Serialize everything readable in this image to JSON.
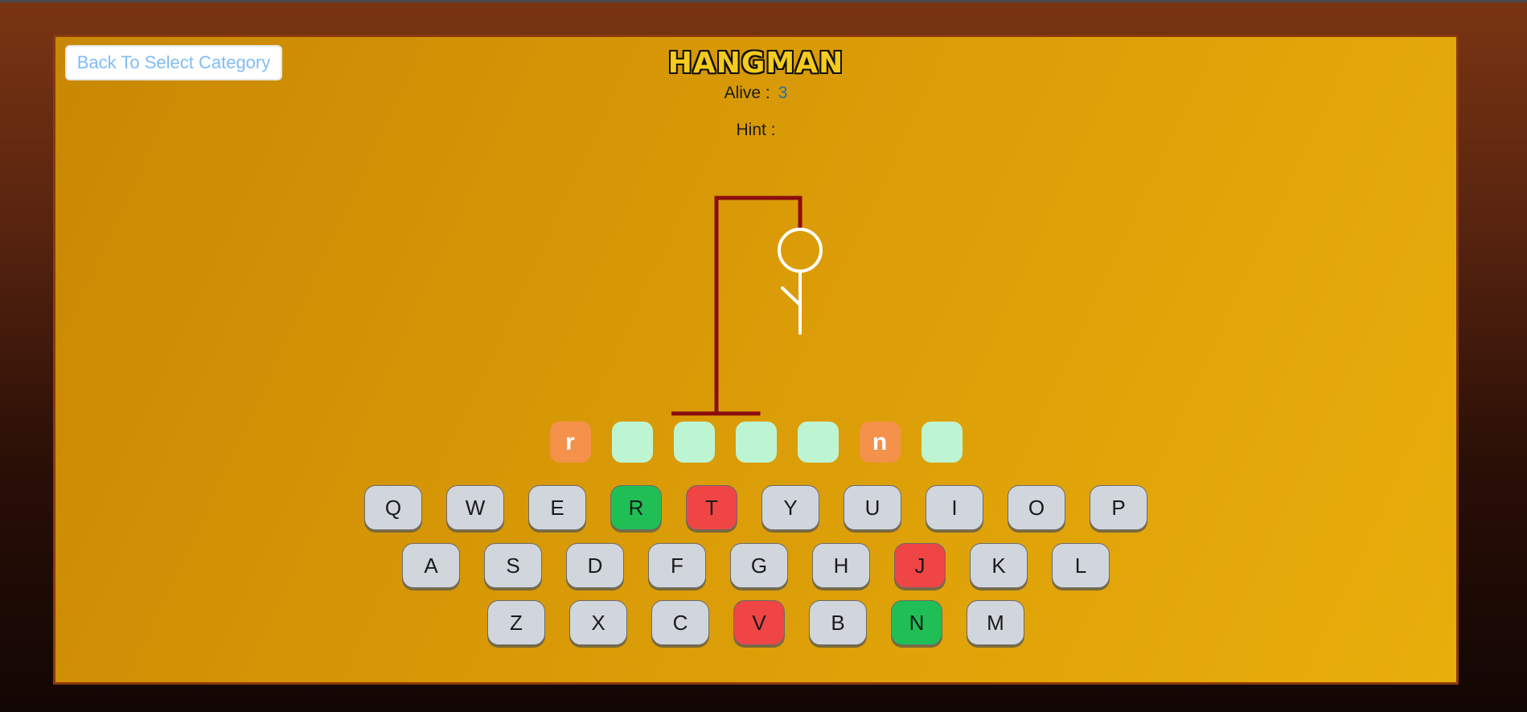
{
  "nav": {
    "back_label": "Back To Select Category"
  },
  "game": {
    "title": "HANGMAN",
    "alive_label": "Alive :",
    "alive_count": "3",
    "hint_label": "Hint :"
  },
  "colors": {
    "board": "#d99a07",
    "gallows": "#8b0e0e",
    "figure": "#ffffff",
    "slot_empty": "#bdf5d2",
    "slot_revealed": "#f4914a",
    "key_default": "#d1d5dc",
    "key_correct": "#1fbf55",
    "key_wrong": "#ef4545"
  },
  "word_slots": [
    "r",
    "",
    "",
    "",
    "",
    "n",
    ""
  ],
  "keyboard": {
    "rows": [
      [
        {
          "letter": "Q",
          "state": "default"
        },
        {
          "letter": "W",
          "state": "default"
        },
        {
          "letter": "E",
          "state": "default"
        },
        {
          "letter": "R",
          "state": "correct"
        },
        {
          "letter": "T",
          "state": "wrong"
        },
        {
          "letter": "Y",
          "state": "default"
        },
        {
          "letter": "U",
          "state": "default"
        },
        {
          "letter": "I",
          "state": "default"
        },
        {
          "letter": "O",
          "state": "default"
        },
        {
          "letter": "P",
          "state": "default"
        }
      ],
      [
        {
          "letter": "A",
          "state": "default"
        },
        {
          "letter": "S",
          "state": "default"
        },
        {
          "letter": "D",
          "state": "default"
        },
        {
          "letter": "F",
          "state": "default"
        },
        {
          "letter": "G",
          "state": "default"
        },
        {
          "letter": "H",
          "state": "default"
        },
        {
          "letter": "J",
          "state": "wrong"
        },
        {
          "letter": "K",
          "state": "default"
        },
        {
          "letter": "L",
          "state": "default"
        }
      ],
      [
        {
          "letter": "Z",
          "state": "default"
        },
        {
          "letter": "X",
          "state": "default"
        },
        {
          "letter": "C",
          "state": "default"
        },
        {
          "letter": "V",
          "state": "wrong"
        },
        {
          "letter": "B",
          "state": "default"
        },
        {
          "letter": "N",
          "state": "correct"
        },
        {
          "letter": "M",
          "state": "default"
        }
      ]
    ]
  }
}
